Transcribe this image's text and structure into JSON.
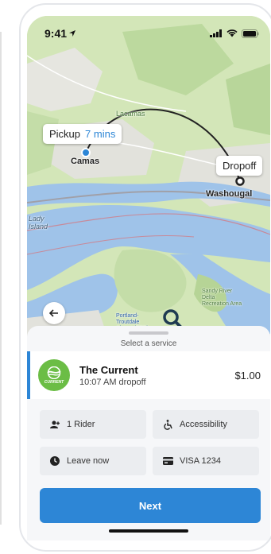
{
  "status_bar": {
    "time": "9:41"
  },
  "map": {
    "pickup_label": "Pickup",
    "pickup_eta": "7 mins",
    "dropoff_label": "Dropoff",
    "places": {
      "camas": "Camas",
      "washougal": "Washougal",
      "lady_island": "Lady\nIsland",
      "sandy_river": "Sandy River\nDelta\nRecreation Area",
      "portland_airport": "Portland-\nTroutdale\nAirport (TTD)",
      "lacamas": "Lacamas"
    },
    "colors": {
      "land": "#d6e7bd",
      "water": "#9fc3e9",
      "route": "#222222",
      "pickup": "#2d86d6"
    }
  },
  "sheet": {
    "title": "Select a service",
    "service": {
      "name": "The Current",
      "eta": "10:07 AM dropoff",
      "price": "$1.00",
      "logo_text": "CURRENT"
    },
    "options": {
      "riders": "1 Rider",
      "accessibility": "Accessibility",
      "departure": "Leave now",
      "payment": "VISA 1234"
    },
    "next_label": "Next",
    "accent": "#2d86d6"
  }
}
